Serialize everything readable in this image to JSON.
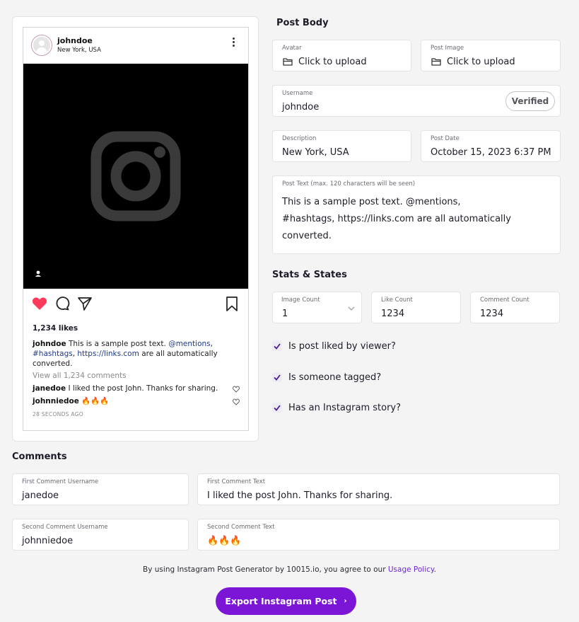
{
  "preview": {
    "username": "johndoe",
    "location": "New York, USA",
    "likes": "1,234 likes",
    "caption_user": "johndoe",
    "caption_text_1": "This is a sample post text.",
    "caption_mention": "@mentions",
    "caption_comma": ",",
    "caption_hashtag": "#hashtags",
    "caption_link": "https://links.com",
    "caption_text_2": "are all automatically converted.",
    "view_all": "View all 1,234 comments",
    "comments": [
      {
        "user": "janedoe",
        "text": "I liked the post John. Thanks for sharing."
      },
      {
        "user": "johnniedoe",
        "text": "🔥🔥🔥"
      }
    ],
    "time_ago": "28 SECONDS AGO"
  },
  "post_body": {
    "title": "Post Body",
    "avatar": {
      "label": "Avatar",
      "value": "Click to upload"
    },
    "post_image": {
      "label": "Post Image",
      "value": "Click to upload"
    },
    "username": {
      "label": "Username",
      "value": "johndoe",
      "verified_label": "Verified"
    },
    "description": {
      "label": "Description",
      "value": "New York, USA"
    },
    "post_date": {
      "label": "Post Date",
      "value": "October 15, 2023 6:37 PM"
    },
    "post_text": {
      "label": "Post Text (max. 120 characters will be seen)",
      "value": "This is a sample post text. @mentions, #hashtags, https://links.com are all automatically converted."
    }
  },
  "stats": {
    "title": "Stats & States",
    "image_count": {
      "label": "Image Count",
      "value": "1"
    },
    "like_count": {
      "label": "Like Count",
      "value": "1234"
    },
    "comment_count": {
      "label": "Comment Count",
      "value": "1234"
    },
    "checks": [
      {
        "label": "Is post liked by viewer?",
        "checked": true
      },
      {
        "label": "Is someone tagged?",
        "checked": true
      },
      {
        "label": "Has an Instagram story?",
        "checked": true
      }
    ]
  },
  "comments_section": {
    "title": "Comments",
    "first_user": {
      "label": "First Comment Username",
      "value": "janedoe"
    },
    "first_text": {
      "label": "First Comment Text",
      "value": "I liked the post John. Thanks for sharing."
    },
    "second_user": {
      "label": "Second Comment Username",
      "value": "johnniedoe"
    },
    "second_text": {
      "label": "Second Comment Text",
      "value": "🔥🔥🔥"
    }
  },
  "footer": {
    "disclaimer": "By using Instagram Post Generator by 10015.io, you agree to our",
    "policy_link": "Usage Policy",
    "period": ".",
    "export_label": "Export Instagram Post",
    "export_arrow": "›"
  },
  "colors": {
    "accent": "#7c16d6",
    "like_red": "#ff3b5c",
    "link_blue": "#1e3a8a",
    "check": "#4c1d95"
  }
}
